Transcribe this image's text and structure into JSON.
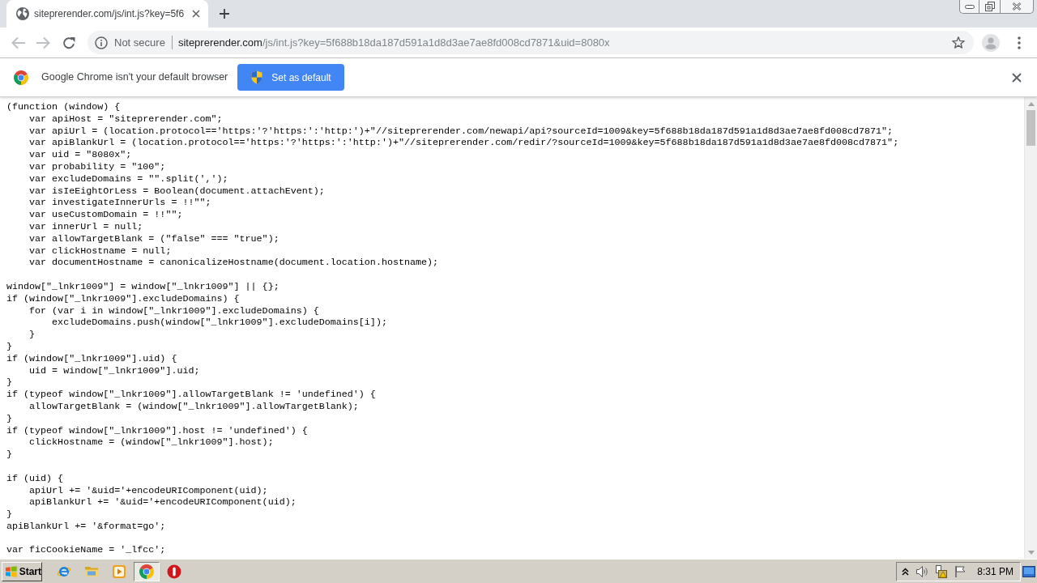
{
  "tabs": [
    {
      "title": "siteprerender.com/js/int.js?key=5f6",
      "selected": true
    }
  ],
  "navigation": {
    "back": {
      "disabled": true
    },
    "forward": {
      "disabled": true
    }
  },
  "address_bar": {
    "security_label": "Not secure",
    "host": "siteprerender.com",
    "path": "/js/int.js?key=5f688b18da187d591a1d8d3ae7ae8fd008cd7871&uid=8080x"
  },
  "infobar": {
    "message": "Google Chrome isn't your default browser",
    "button": "Set as default"
  },
  "code_blocks": [
    [
      "(function (window) {",
      "    var apiHost = \"siteprerender.com\";",
      "    var apiUrl = (location.protocol=='https:'?'https:':'http:')+\"//siteprerender.com/newapi/api?sourceId=1009&key=5f688b18da187d591a1d8d3ae7ae8fd008cd7871\";",
      "    var apiBlankUrl = (location.protocol=='https:'?'https:':'http:')+\"//siteprerender.com/redir/?sourceId=1009&key=5f688b18da187d591a1d8d3ae7ae8fd008cd7871\";",
      "    var uid = \"8080x\";",
      "    var probability = \"100\";",
      "    var excludeDomains = \"\".split(',');",
      "    var isIeEightOrLess = Boolean(document.attachEvent);",
      "    var investigateInnerUrls = !!\"\";",
      "    var useCustomDomain = !!\"\";",
      "    var innerUrl = null;",
      "    var allowTargetBlank = (\"false\" === \"true\");",
      "    var clickHostname = null;",
      "    var documentHostname = canonicalizeHostname(document.location.hostname);"
    ],
    [
      "window[\"_lnkr1009\"] = window[\"_lnkr1009\"] || {};",
      "if (window[\"_lnkr1009\"].excludeDomains) {",
      "    for (var i in window[\"_lnkr1009\"].excludeDomains) {",
      "        excludeDomains.push(window[\"_lnkr1009\"].excludeDomains[i]);",
      "    }",
      "}",
      "if (window[\"_lnkr1009\"].uid) {",
      "    uid = window[\"_lnkr1009\"].uid;",
      "}",
      "if (typeof window[\"_lnkr1009\"].allowTargetBlank != 'undefined') {",
      "    allowTargetBlank = (window[\"_lnkr1009\"].allowTargetBlank);",
      "}",
      "if (typeof window[\"_lnkr1009\"].host != 'undefined') {",
      "    clickHostname = (window[\"_lnkr1009\"].host);",
      "}"
    ],
    [
      "if (uid) {",
      "    apiUrl += '&uid='+encodeURIComponent(uid);",
      "    apiBlankUrl += '&uid='+encodeURIComponent(uid);",
      "}",
      "apiBlankUrl += '&format=go';"
    ],
    [
      "var ficCookieName = '_lfcc';"
    ]
  ],
  "taskbar": {
    "start": "Start",
    "apps": [
      {
        "kind": "web",
        "selected": false
      },
      {
        "kind": "folder",
        "selected": false
      },
      {
        "kind": "player",
        "selected": false
      },
      {
        "kind": "browser",
        "selected": true
      },
      {
        "kind": "alert",
        "selected": false
      }
    ],
    "clock": "8:31 PM"
  }
}
